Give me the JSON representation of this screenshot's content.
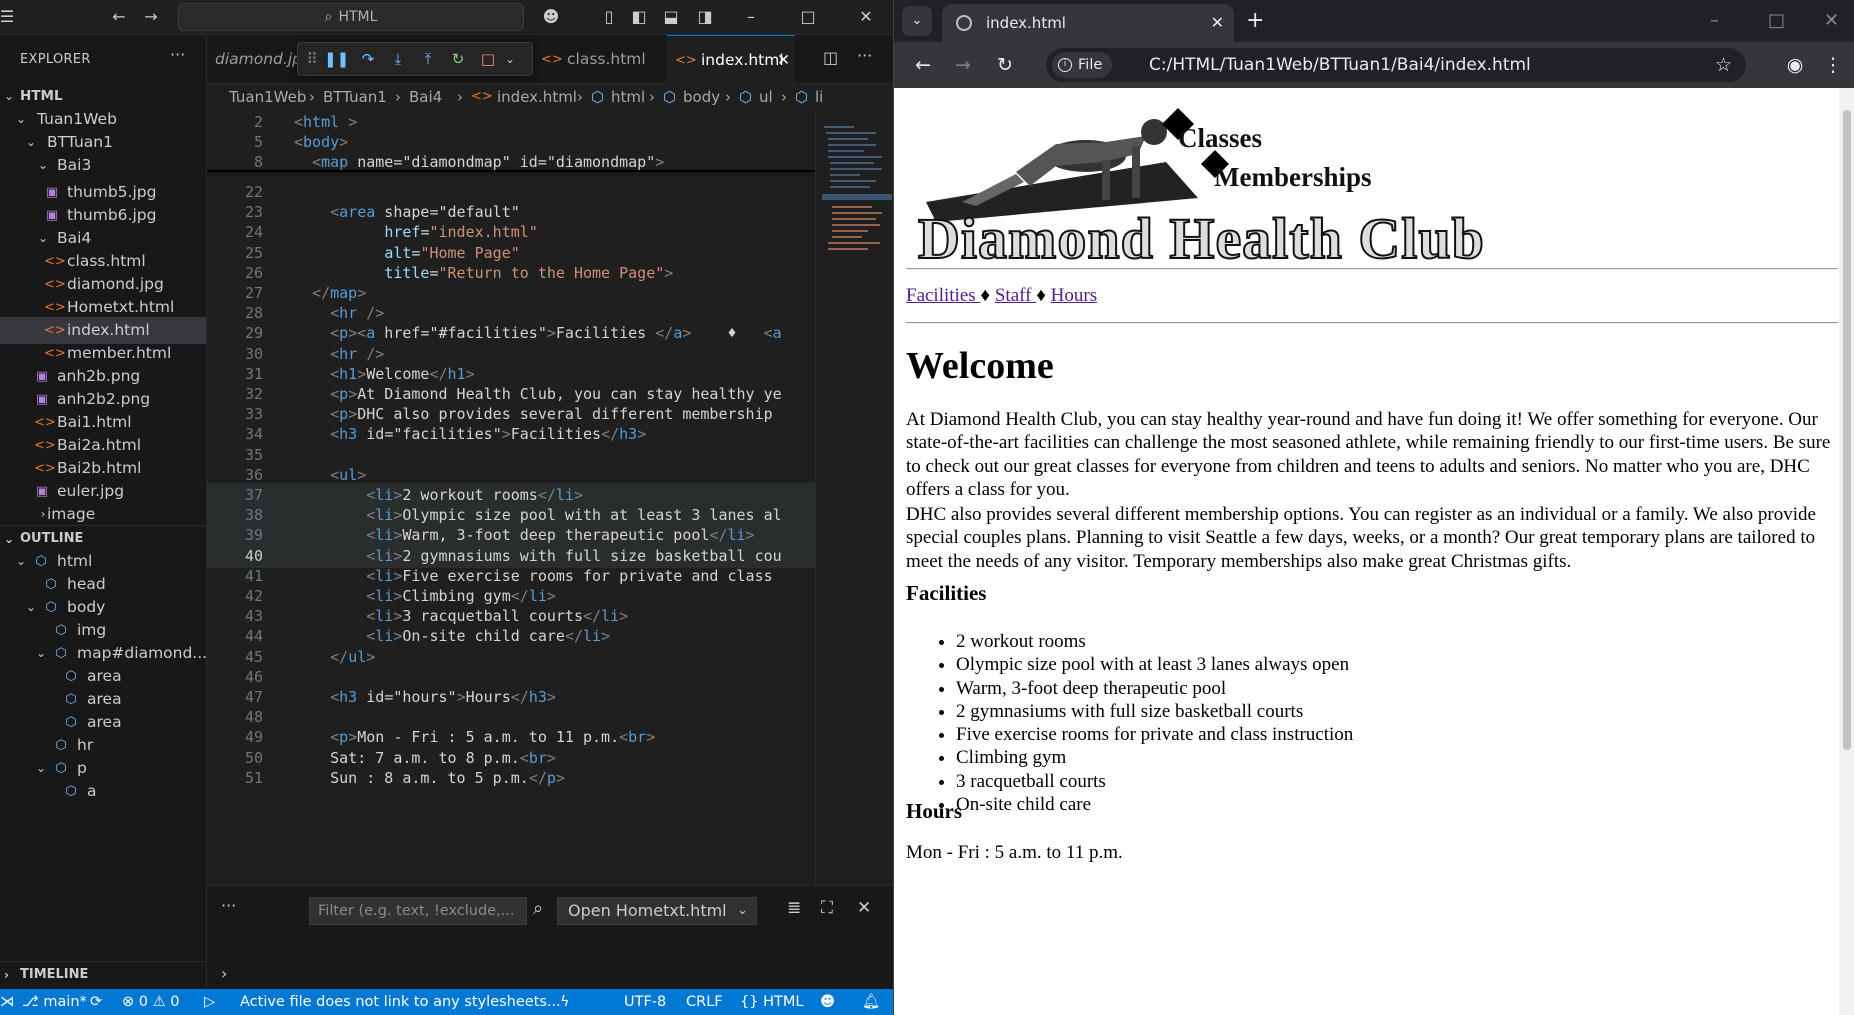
{
  "vscode": {
    "command_center": "HTML",
    "explorer": {
      "title": "EXPLORER",
      "root": "HTML",
      "items": [
        {
          "label": "Tuan1Web"
        },
        {
          "label": "BTTuan1"
        },
        {
          "label": "Bai3"
        },
        {
          "label": "thumb5.jpg"
        },
        {
          "label": "thumb6.jpg"
        },
        {
          "label": "Bai4"
        },
        {
          "label": "class.html"
        },
        {
          "label": "diamond.jpg"
        },
        {
          "label": "Hometxt.html"
        },
        {
          "label": "index.html"
        },
        {
          "label": "member.html"
        },
        {
          "label": "anh2b.png"
        },
        {
          "label": "anh2b2.png"
        },
        {
          "label": "Bai1.html"
        },
        {
          "label": "Bai2a.html"
        },
        {
          "label": "Bai2b.html"
        },
        {
          "label": "euler.jpg"
        },
        {
          "label": "image"
        }
      ]
    },
    "outline": {
      "title": "OUTLINE",
      "items": [
        {
          "label": "html"
        },
        {
          "label": "head"
        },
        {
          "label": "body"
        },
        {
          "label": "img"
        },
        {
          "label": "map#diamond..."
        },
        {
          "label": "area"
        },
        {
          "label": "area"
        },
        {
          "label": "area"
        },
        {
          "label": "hr"
        },
        {
          "label": "p"
        },
        {
          "label": "a"
        }
      ]
    },
    "timeline_title": "TIMELINE",
    "tabs": [
      {
        "label": "diamond.jp"
      },
      {
        "label": "class.html"
      },
      {
        "label": "index.html"
      }
    ],
    "breadcrumb": [
      "Tuan1Web",
      "BTTuan1",
      "Bai4",
      "index.html",
      "html",
      "body",
      "ul",
      "li"
    ],
    "code_lines": [
      {
        "n": "2",
        "t": "<html >"
      },
      {
        "n": "5",
        "t": "<body>"
      },
      {
        "n": "8",
        "t": "  <map name=\"diamondmap\" id=\"diamondmap\">"
      },
      {
        "n": "22",
        "t": ""
      },
      {
        "n": "23",
        "t": "    <area shape=\"default\""
      },
      {
        "n": "24",
        "t": "          href=\"index.html\""
      },
      {
        "n": "25",
        "t": "          alt=\"Home Page\""
      },
      {
        "n": "26",
        "t": "          title=\"Return to the Home Page\">"
      },
      {
        "n": "27",
        "t": "  </map>"
      },
      {
        "n": "28",
        "t": "    <hr />"
      },
      {
        "n": "29",
        "t": "    <p><a href=\"#facilities\">Facilities </a>    ♦   <a"
      },
      {
        "n": "30",
        "t": "    <hr />"
      },
      {
        "n": "31",
        "t": "    <h1>Welcome</h1>"
      },
      {
        "n": "32",
        "t": "    <p>At Diamond Health Club, you can stay healthy ye"
      },
      {
        "n": "33",
        "t": "    <p>DHC also provides several different membership "
      },
      {
        "n": "34",
        "t": "    <h3 id=\"facilities\">Facilities</h3>"
      },
      {
        "n": "35",
        "t": ""
      },
      {
        "n": "36",
        "t": "    <ul>"
      },
      {
        "n": "37",
        "t": "        <li>2 workout rooms</li>"
      },
      {
        "n": "38",
        "t": "        <li>Olympic size pool with at least 3 lanes al"
      },
      {
        "n": "39",
        "t": "        <li>Warm, 3-foot deep therapeutic pool</li>"
      },
      {
        "n": "40",
        "t": "        <li>2 gymnasiums with full size basketball cou"
      },
      {
        "n": "41",
        "t": "        <li>Five exercise rooms for private and class "
      },
      {
        "n": "42",
        "t": "        <li>Climbing gym</li>"
      },
      {
        "n": "43",
        "t": "        <li>3 racquetball courts</li>"
      },
      {
        "n": "44",
        "t": "        <li>On-site child care</li>"
      },
      {
        "n": "45",
        "t": "    </ul>"
      },
      {
        "n": "46",
        "t": ""
      },
      {
        "n": "47",
        "t": "    <h3 id=\"hours\">Hours</h3>"
      },
      {
        "n": "48",
        "t": ""
      },
      {
        "n": "49",
        "t": "    <p>Mon - Fri : 5 a.m. to 11 p.m.<br>"
      },
      {
        "n": "50",
        "t": "    Sat: 7 a.m. to 8 p.m.<br>"
      },
      {
        "n": "51",
        "t": "    Sun : 8 a.m. to 5 p.m.</p>"
      }
    ],
    "panel": {
      "filter_placeholder": "Filter (e.g. text, !exclude,...",
      "channel": "Open Hometxt.html"
    },
    "status": {
      "branch": "main*",
      "errors": "0",
      "warnings": "0",
      "message": "Active file does not link to any stylesheets...",
      "encoding": "UTF-8",
      "eol": "CRLF",
      "language": "HTML"
    }
  },
  "browser": {
    "tab_title": "index.html",
    "url_chip": "File",
    "url": "C:/HTML/Tuan1Web/BTTuan1/Bai4/index.html",
    "page": {
      "logo_line1": "Classes",
      "logo_line2": "Memberships",
      "logo_title": "Diamond Health Club",
      "nav": [
        "Facilities ",
        "Staff ",
        "Hours"
      ],
      "nav_sep": "♦",
      "welcome": "Welcome",
      "para1": "At Diamond Health Club, you can stay healthy year-round and have fun doing it! We offer something for everyone. Our state-of-the-art facilities can challenge the most seasoned athlete, while remaining friendly to our first-time users. Be sure to check out our great classes for everyone from children and teens to adults and seniors. No matter who you are, DHC offers a class for you.",
      "para2": "DHC also provides several different membership options. You can register as an individual or a family. We also provide special couples plans. Planning to visit Seattle a few days, weeks, or a month? Our great temporary plans are tailored to meet the needs of any visitor. Temporary memberships also make great Christmas gifts.",
      "facilities_heading": "Facilities",
      "facilities": [
        "2 workout rooms",
        "Olympic size pool with at least 3 lanes always open",
        "Warm, 3-foot deep therapeutic pool",
        "2 gymnasiums with full size basketball courts",
        "Five exercise rooms for private and class instruction",
        "Climbing gym",
        "3 racquetball courts",
        "On-site child care"
      ],
      "hours_heading": "Hours",
      "hours_first": "Mon - Fri : 5 a.m. to 11 p.m."
    }
  }
}
